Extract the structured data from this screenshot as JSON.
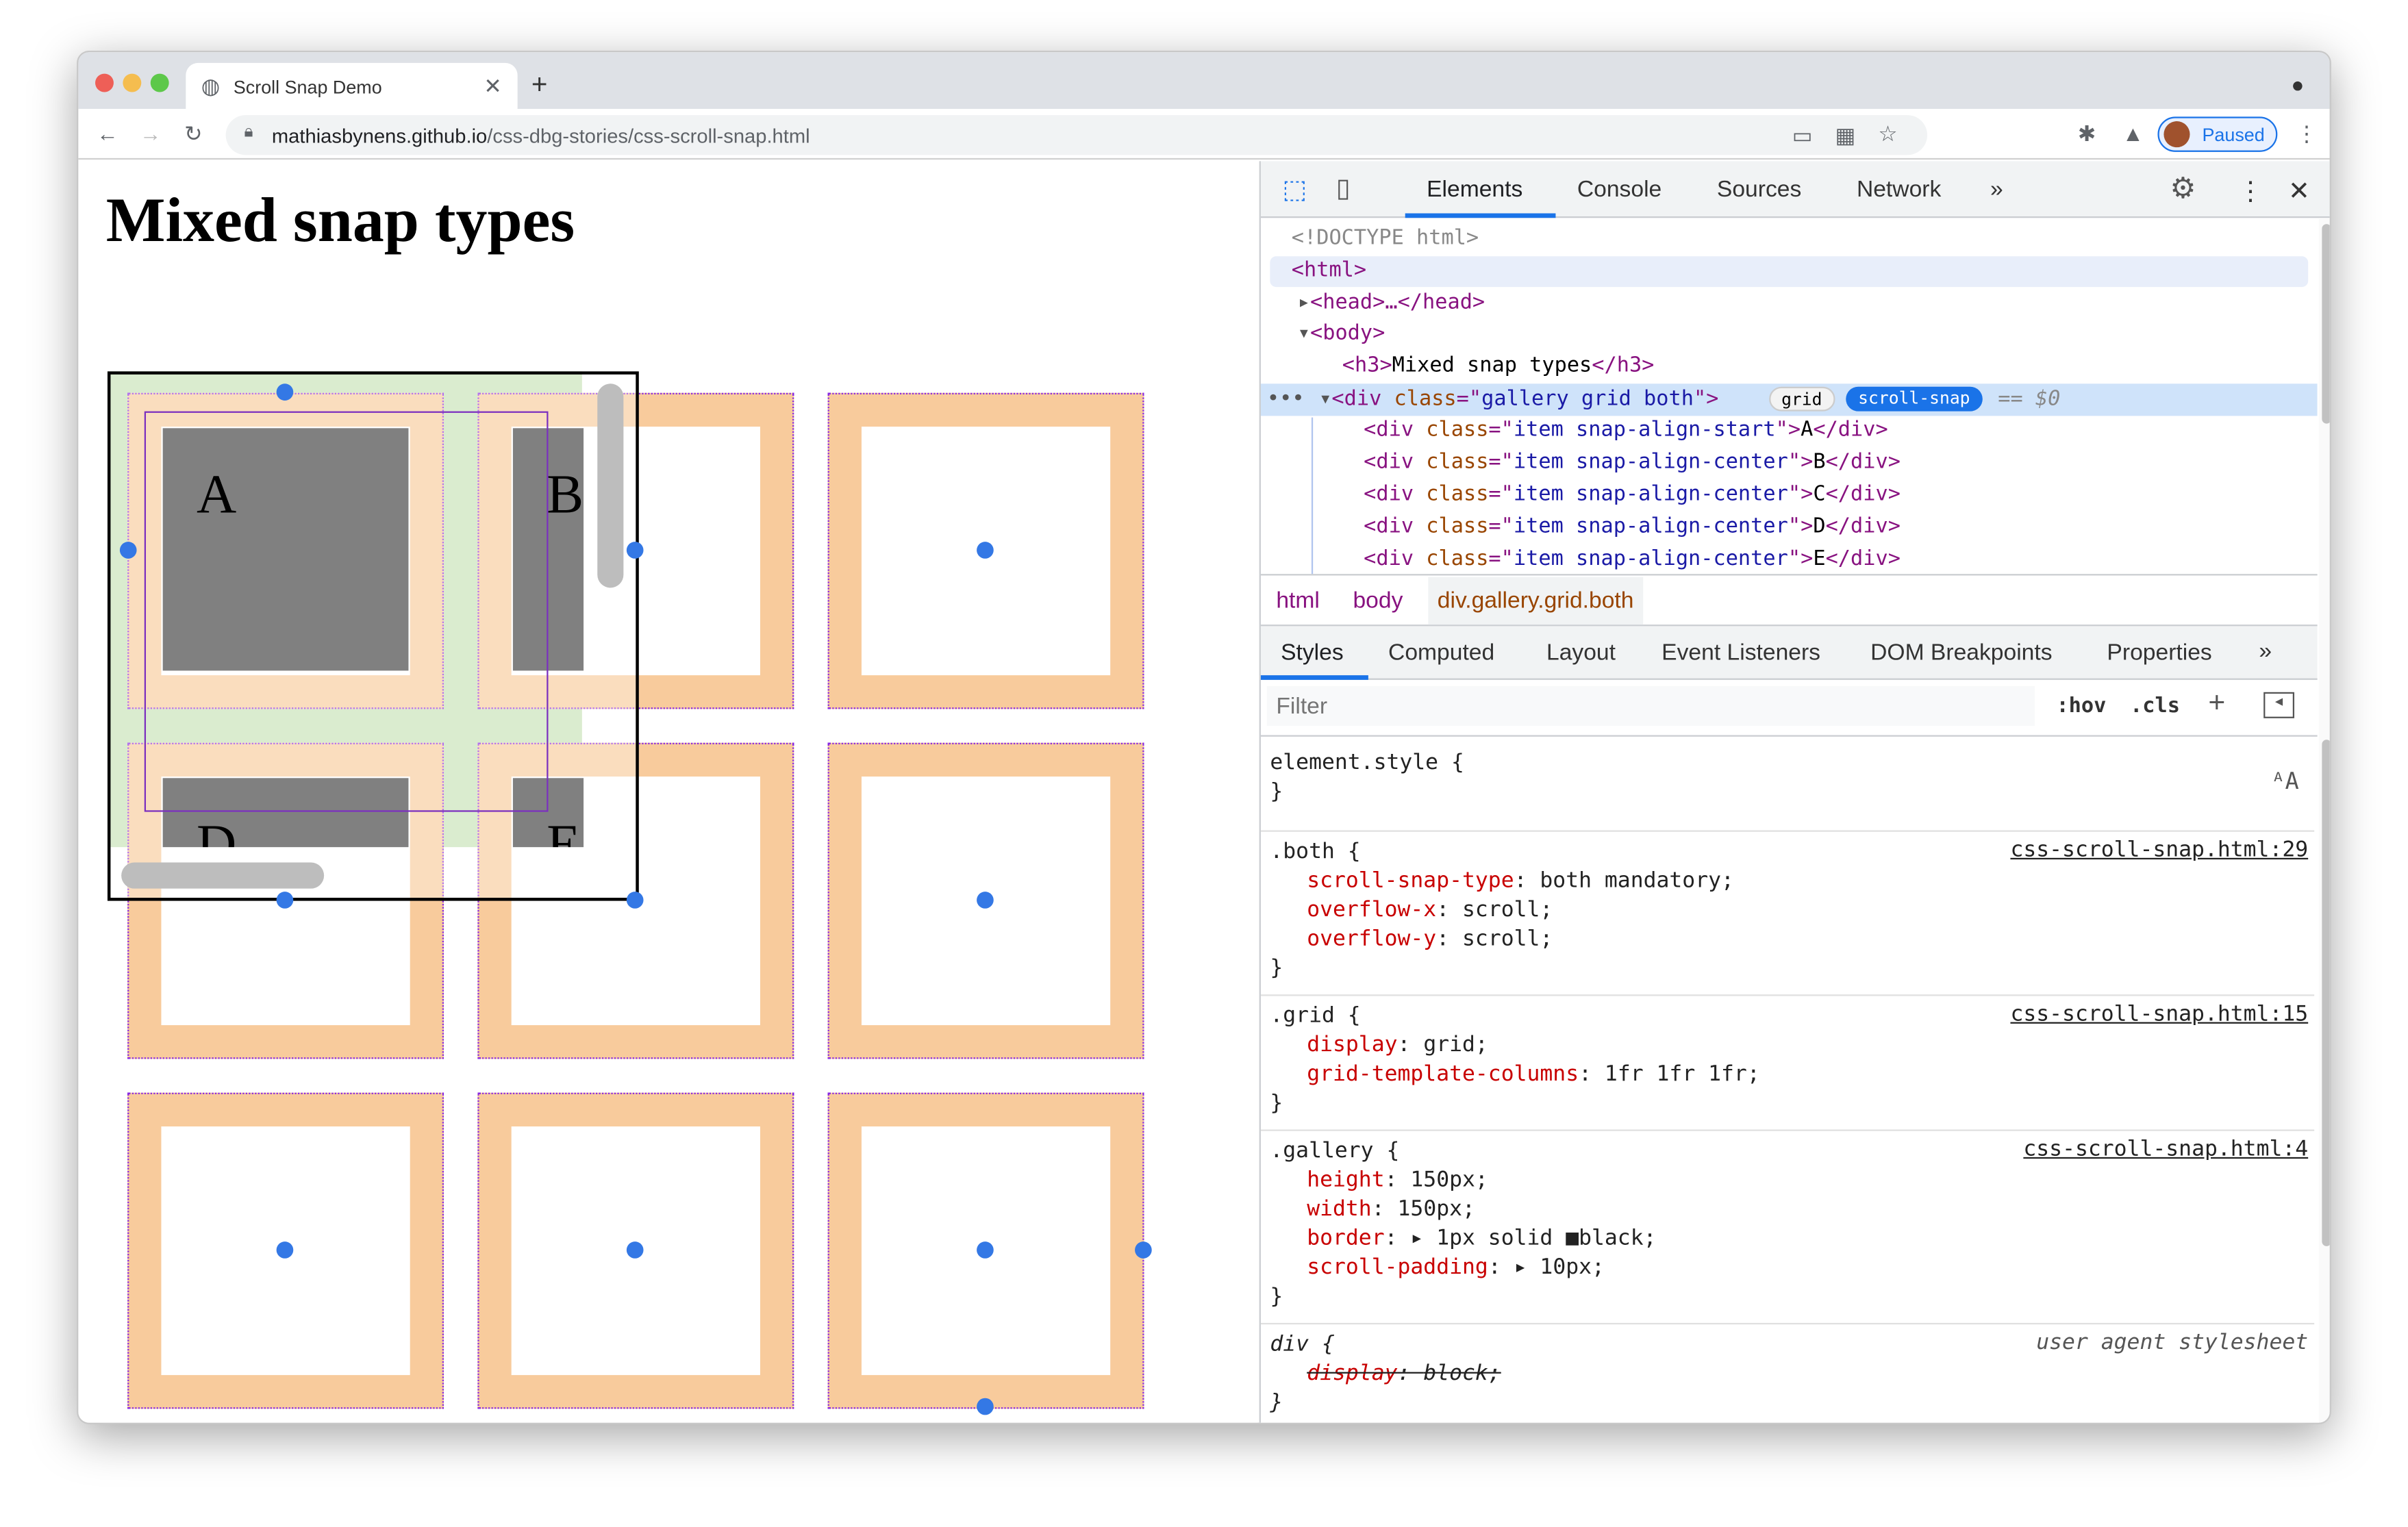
{
  "browser": {
    "tab_title": "Scroll Snap Demo",
    "url_host": "mathiasbynens.github.io",
    "url_path": "/css-dbg-stories/css-scroll-snap.html",
    "profile_label": "Paused",
    "accent": "#1a73e8"
  },
  "page": {
    "title": "Mixed snap types",
    "items": [
      "A",
      "B",
      "",
      "D",
      "E",
      "",
      "",
      "",
      ""
    ],
    "item_border_color": "#f8cb9c",
    "snap_dot_color": "#3478e5"
  },
  "devtools": {
    "tabs": [
      "Elements",
      "Console",
      "Sources",
      "Network"
    ],
    "active_tab": "Elements",
    "dom": {
      "doctype": "<!DOCTYPE html>",
      "html": "<html>",
      "head": "<head>…</head>",
      "body": "<body>",
      "h3_text": "Mixed snap types",
      "div_class": "gallery grid both",
      "badge_grid": "grid",
      "badge_snap": "scroll-snap",
      "selected_marker": "== $0",
      "children": [
        {
          "cls": "item snap-align-start",
          "text": "A"
        },
        {
          "cls": "item snap-align-center",
          "text": "B"
        },
        {
          "cls": "item snap-align-center",
          "text": "C"
        },
        {
          "cls": "item snap-align-center",
          "text": "D"
        },
        {
          "cls": "item snap-align-center",
          "text": "E"
        }
      ]
    },
    "breadcrumb": [
      "html",
      "body",
      "div.gallery.grid.both"
    ],
    "subtabs": [
      "Styles",
      "Computed",
      "Layout",
      "Event Listeners",
      "DOM Breakpoints",
      "Properties"
    ],
    "active_subtab": "Styles",
    "filter_placeholder": "Filter",
    "hov": ":hov",
    "cls": ".cls",
    "rules": [
      {
        "selector": "element.style {",
        "source": "",
        "decls": []
      },
      {
        "selector": ".both {",
        "source": "css-scroll-snap.html:29",
        "decls": [
          [
            "scroll-snap-type",
            "both mandatory;"
          ],
          [
            "overflow-x",
            "scroll;"
          ],
          [
            "overflow-y",
            "scroll;"
          ]
        ]
      },
      {
        "selector": ".grid {",
        "source": "css-scroll-snap.html:15",
        "decls": [
          [
            "display",
            "grid;"
          ],
          [
            "grid-template-columns",
            "1fr 1fr 1fr;"
          ]
        ]
      },
      {
        "selector": ".gallery {",
        "source": "css-scroll-snap.html:4",
        "decls": [
          [
            "height",
            "150px;"
          ],
          [
            "width",
            "150px;"
          ],
          [
            "border",
            "▸ 1px solid ■black;"
          ],
          [
            "scroll-padding",
            "▸ 10px;"
          ]
        ]
      },
      {
        "selector": "div {",
        "source": "user agent stylesheet",
        "decls": [
          [
            "display",
            "block;"
          ]
        ]
      }
    ]
  }
}
